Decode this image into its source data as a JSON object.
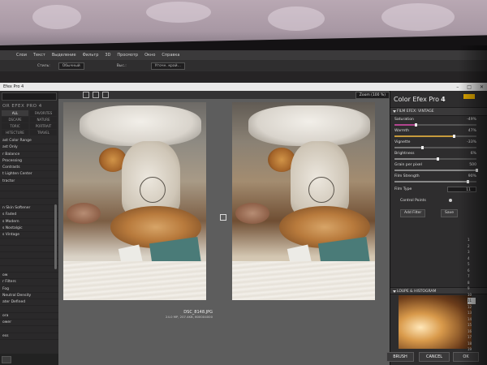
{
  "ps_menu": [
    "Слои",
    "Текст",
    "Выделение",
    "Фильтр",
    "3D",
    "Просмотр",
    "Окно",
    "Справка"
  ],
  "ps_options": {
    "item1": "Стиль:",
    "box1": "Обычный",
    "item2": "Выс.:",
    "box2": "Уточн. край..."
  },
  "plugin": {
    "title": "Efex Pro 4",
    "window_buttons": [
      "–",
      "□",
      "✕"
    ]
  },
  "left_panel": {
    "title": "OR EFEX PRO 4",
    "categories": [
      {
        "label": "ALL",
        "active": true
      },
      {
        "label": "FAVORITES",
        "active": false
      },
      {
        "label": "DSCAPE",
        "active": false
      },
      {
        "label": "NATURE",
        "active": false
      },
      {
        "label": "TORIC",
        "active": false
      },
      {
        "label": "PORTRAIT",
        "active": false
      },
      {
        "label": "HITECTURE",
        "active": false
      },
      {
        "label": "TRAVEL",
        "active": false
      }
    ],
    "filters": [
      "ast Color Range",
      "ast Only",
      "r Balance",
      "Processing",
      "Contrasts",
      "t Lighten Center",
      "tractor",
      "",
      "",
      "",
      "n Skin Softener",
      "s Faded",
      "s Modern",
      "s Nostalgic",
      "s Vintage",
      "",
      "",
      "",
      "",
      "",
      "ow",
      "r Filters",
      "Fog",
      "Neutral Density",
      "ater Defined",
      "",
      "ora",
      "ower",
      "",
      "ess"
    ]
  },
  "center": {
    "zoom_label": "Zoom (100 %)",
    "filename": "DSC_8148.JPG",
    "file_info": "24.0 MP, 207.4KB, 6000X4000"
  },
  "right_panel": {
    "app_name": "Color Efex Pro",
    "app_version": "4",
    "section_title": "FILM EFEX: VINTAGE",
    "sliders": [
      {
        "label": "Saturation",
        "value": "-49%",
        "frac": 0.26,
        "color": "#b2458f"
      },
      {
        "label": "Warmth",
        "value": "47%",
        "frac": 0.73,
        "color": "#c69a3c"
      },
      {
        "label": "Vignette",
        "value": "-33%",
        "frac": 0.34,
        "color": "#777777"
      },
      {
        "label": "Brightness",
        "value": "6%",
        "frac": 0.53,
        "color": "#888888"
      },
      {
        "label": "Grain per pixel",
        "value": "500",
        "frac": 1.0,
        "color": "#888888"
      },
      {
        "label": "Film Strength",
        "value": "90%",
        "frac": 0.9,
        "color": "#888888"
      }
    ],
    "film_type_label": "Film Type",
    "film_type_value": "11",
    "control_points_label": "Control Points",
    "add_filter": "Add Filter",
    "save": "Save",
    "loupe_label": "LOUPE & HISTOGRAM",
    "film_numbers": [
      "1",
      "2",
      "3",
      "4",
      "5",
      "6",
      "7",
      "8",
      "9",
      "10",
      "11",
      "12",
      "13",
      "14",
      "15",
      "16",
      "17",
      "18",
      "19",
      "20"
    ],
    "selected_number": "11"
  },
  "bottom_buttons": {
    "brush": "BRUSH",
    "cancel": "CANCEL",
    "ok": "OK"
  }
}
